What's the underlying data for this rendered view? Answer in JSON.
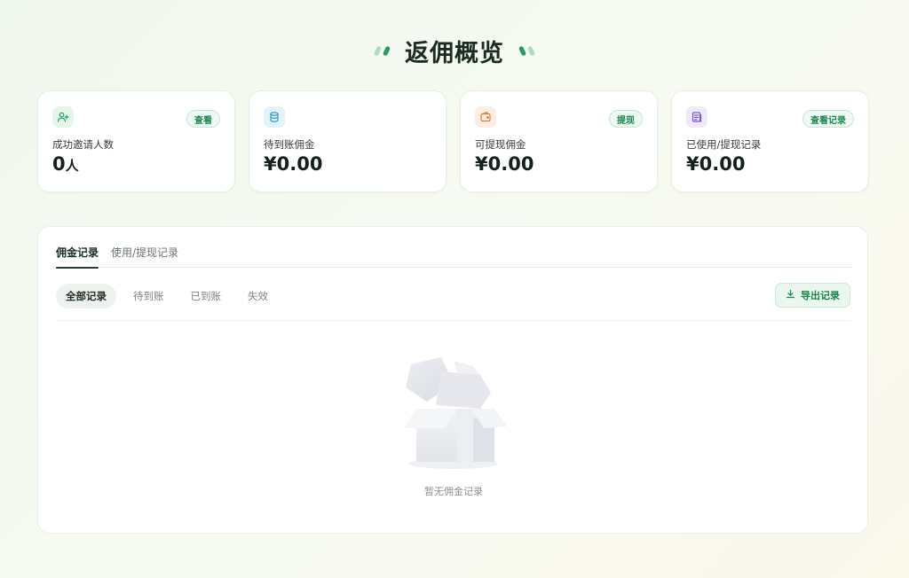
{
  "page": {
    "title": "返佣概览"
  },
  "cards": [
    {
      "icon": "user-plus-icon",
      "badge": "查看",
      "label": "成功邀请人数",
      "value": "0",
      "unit": "人"
    },
    {
      "icon": "coins-icon",
      "badge": "",
      "label": "待到账佣金",
      "value": "¥0.00",
      "unit": ""
    },
    {
      "icon": "wallet-icon",
      "badge": "提现",
      "label": "可提现佣金",
      "value": "¥0.00",
      "unit": ""
    },
    {
      "icon": "document-icon",
      "badge": "查看记录",
      "label": "已使用/提现记录",
      "value": "¥0.00",
      "unit": ""
    }
  ],
  "tabs": [
    {
      "label": "佣金记录",
      "active": true
    },
    {
      "label": "使用/提现记录",
      "active": false
    }
  ],
  "filters": [
    {
      "label": "全部记录",
      "active": true
    },
    {
      "label": "待到账",
      "active": false
    },
    {
      "label": "已到账",
      "active": false
    },
    {
      "label": "失效",
      "active": false
    }
  ],
  "export": {
    "label": "导出记录",
    "icon": "download-icon"
  },
  "empty": {
    "text": "暂无佣金记录",
    "icon": "empty-box-icon"
  },
  "colors": {
    "accent": "#19874f",
    "accent_bg": "#eaf7ef"
  }
}
